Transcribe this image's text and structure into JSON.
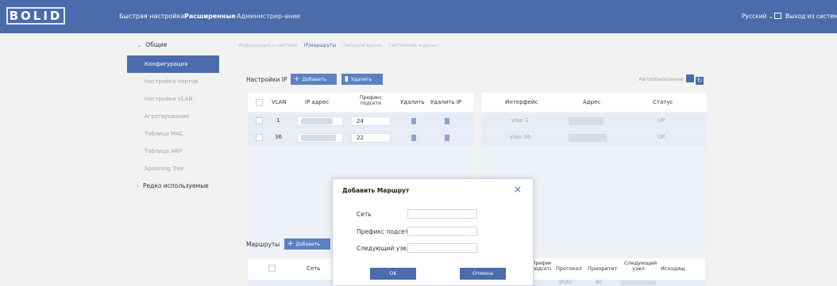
{
  "brand": {
    "logo_text": "BOLID"
  },
  "topnav": {
    "quick_setup": "Быстрая настройка",
    "advanced": "Расширенные",
    "admin": "Администрир-ание",
    "language": "Русский",
    "logout": "Выход из систем"
  },
  "sidebar": {
    "group_general": "Общие",
    "items": [
      {
        "label": "Конфигурация",
        "active": true
      },
      {
        "label": "Настройка портов"
      },
      {
        "label": "Настройки VLAN"
      },
      {
        "label": "Агрегирование"
      },
      {
        "label": "Таблица MAC"
      },
      {
        "label": "Таблица ARP"
      },
      {
        "label": "Spanning Tree"
      }
    ],
    "group_rare": "Редко используемые"
  },
  "tabs": [
    {
      "label": "Информация о системе"
    },
    {
      "label": "IP/маршруты",
      "active": true
    },
    {
      "label": "Текущие время"
    },
    {
      "label": "Системный журнал"
    }
  ],
  "ip_section": {
    "title": "Настройки IP",
    "add_label": "Добавить",
    "delete_label": "Удалить",
    "auto_refresh": "Автообновление",
    "left_headers": {
      "vlan": "VLAN",
      "ip": "IP адрес",
      "prefix": "Префикс подсети",
      "del1": "Удалить",
      "del2": "Удалить IP"
    },
    "left_rows": [
      {
        "vlan": "1",
        "prefix": "24"
      },
      {
        "vlan": "36",
        "prefix": "22"
      }
    ],
    "right_headers": {
      "interface": "Интерфейс",
      "address": "Адрес",
      "status": "Статус"
    },
    "right_rows": [
      {
        "interface": "vlan 1",
        "status": "UP"
      },
      {
        "interface": "vlan 36",
        "status": "UP"
      }
    ]
  },
  "routes_section": {
    "title": "Маршруты",
    "add_label": "Добавить",
    "headers": {
      "network": "Сеть",
      "prefix": "Префикс подсети",
      "protocol": "Протокол",
      "priority": "Приоритет",
      "next_hop": "Следующий узел",
      "outgoing": "Исходящ"
    },
    "row": {
      "protocol": "Static",
      "priority": "60"
    }
  },
  "modal": {
    "title": "Добавить Маршрут",
    "close": "×",
    "fields": {
      "network": "Сеть",
      "prefix": "Префикс подсети",
      "next_hop": "Следующий узел"
    },
    "ok": "OK",
    "cancel": "Отмена"
  },
  "colors": {
    "primary": "#4a6cab",
    "button": "#5d80c4",
    "background": "#f2f2f2"
  }
}
